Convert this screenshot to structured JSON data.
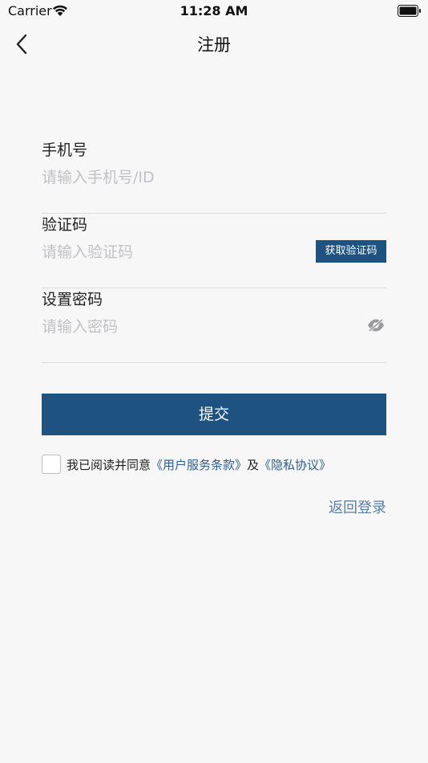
{
  "status_bar": {
    "carrier": "Carrier",
    "time": "11:28 AM",
    "icons": [
      "wifi-icon",
      "battery-icon"
    ]
  },
  "nav": {
    "title": "注册",
    "back_icon": "chevron-left-icon"
  },
  "form": {
    "phone": {
      "label": "手机号",
      "placeholder": "请输入手机号/ID",
      "value": ""
    },
    "code": {
      "label": "验证码",
      "placeholder": "请输入验证码",
      "value": "",
      "button_label": "获取验证码"
    },
    "password": {
      "label": "设置密码",
      "placeholder": "请输入密码",
      "value": "",
      "toggle_icon": "eye-slash-icon"
    },
    "submit_label": "提交"
  },
  "agreement": {
    "prefix": "我已阅读并同意",
    "terms_link": "《用户服务条款》",
    "conjunction": "及",
    "privacy_link": "《隐私协议》",
    "checked": false
  },
  "back_to_login": "返回登录",
  "colors": {
    "primary": "#1d5281",
    "link": "#2b5f91",
    "background": "#f7f7f7",
    "placeholder": "#c2c2c6"
  }
}
